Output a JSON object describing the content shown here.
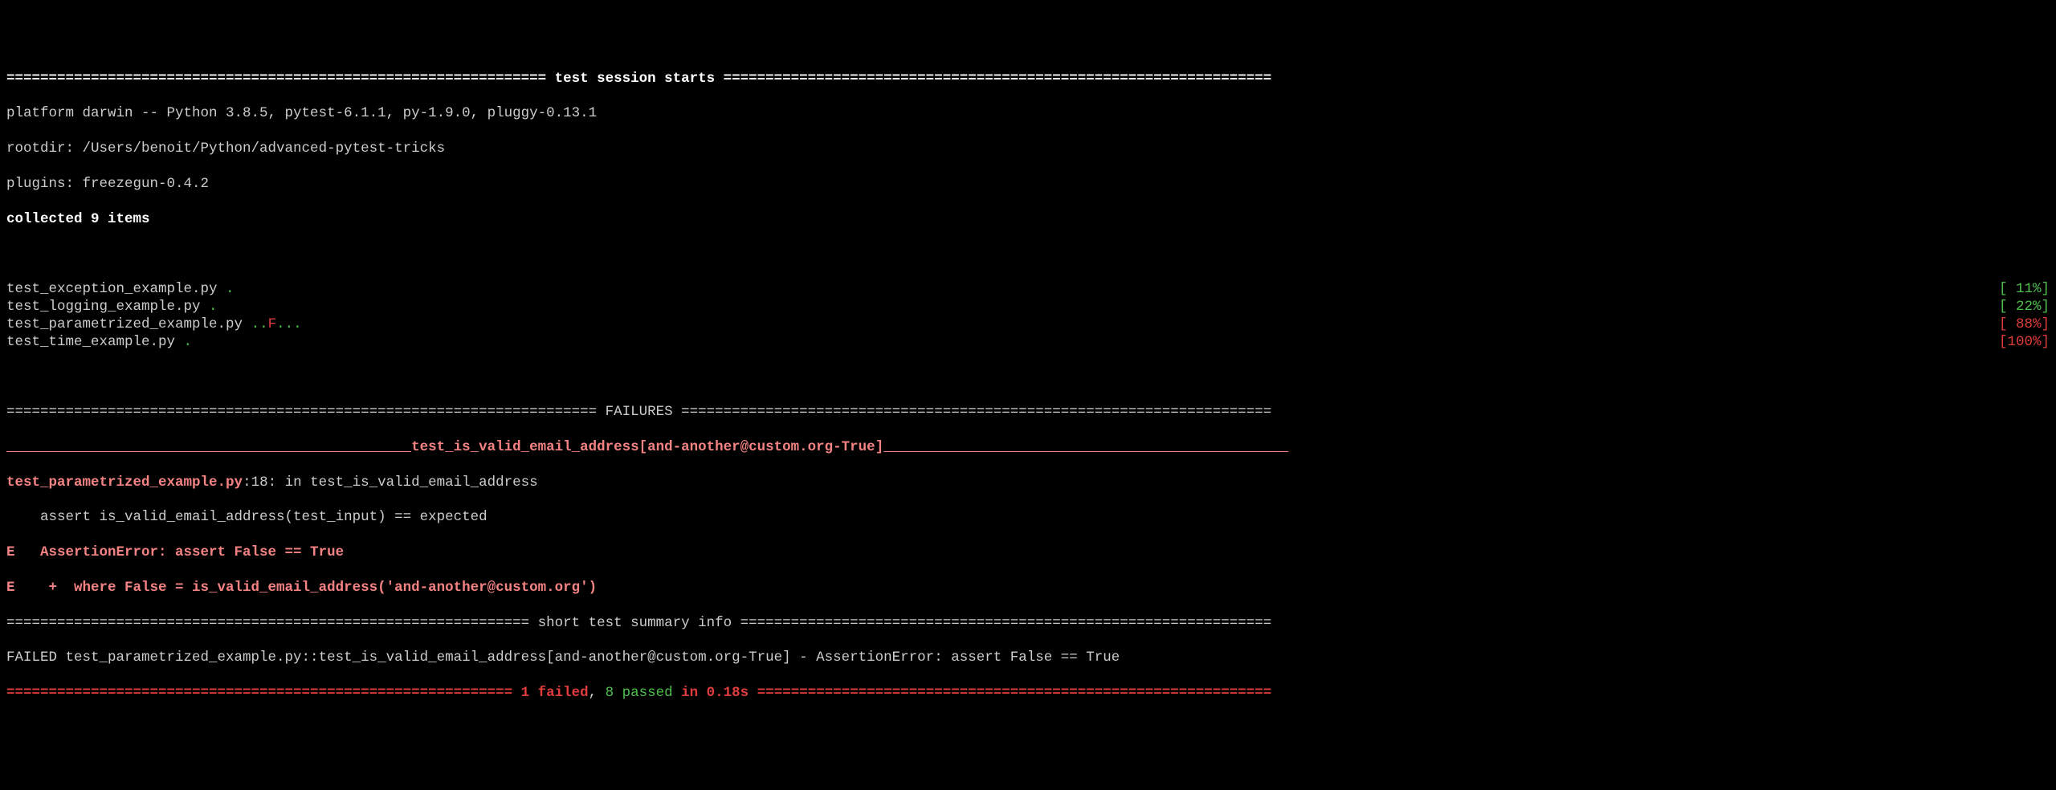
{
  "session_header": "================================================================ test session starts =================================================================",
  "platform_line": "platform darwin -- Python 3.8.5, pytest-6.1.1, py-1.9.0, pluggy-0.13.1",
  "rootdir_line": "rootdir: /Users/benoit/Python/advanced-pytest-tricks",
  "plugins_line": "plugins: freezegun-0.4.2",
  "collected_line": "collected 9 items",
  "tests": [
    {
      "file": "test_exception_example.py ",
      "marks": ".",
      "fail_marks": "",
      "after_marks": "",
      "pct": "[ 11%]",
      "pct_class": "green"
    },
    {
      "file": "test_logging_example.py ",
      "marks": ".",
      "fail_marks": "",
      "after_marks": "",
      "pct": "[ 22%]",
      "pct_class": "green"
    },
    {
      "file": "test_parametrized_example.py ",
      "marks": "..",
      "fail_marks": "F",
      "after_marks": "...",
      "pct": "[ 88%]",
      "pct_class": "red"
    },
    {
      "file": "test_time_example.py ",
      "marks": ".",
      "fail_marks": "",
      "after_marks": "",
      "pct": "[100%]",
      "pct_class": "red"
    }
  ],
  "failures_header": "====================================================================== FAILURES ======================================================================",
  "test_name_line_left": "_______________________________________________ ",
  "test_name_line_center": "test_is_valid_email_address[and-another@custom.org-True]",
  "test_name_line_right": " _______________________________________________",
  "traceback": {
    "location_file": "test_parametrized_example.py",
    "location_rest": ":18: in test_is_valid_email_address",
    "code_line": "    assert is_valid_email_address(test_input) == expected",
    "err1": "E   AssertionError: assert False == True",
    "err2": "E    +  where False = is_valid_email_address('and-another@custom.org')"
  },
  "summary_header": "============================================================== short test summary info ===============================================================",
  "failed_summary": "FAILED test_parametrized_example.py::test_is_valid_email_address[and-another@custom.org-True] - AssertionError: assert False == True",
  "final": {
    "left": "============================================================ ",
    "failed": "1 failed",
    "sep1": ", ",
    "passed": "8 passed",
    "sep2": " ",
    "time": "in 0.18s",
    "right": " ============================================================="
  }
}
